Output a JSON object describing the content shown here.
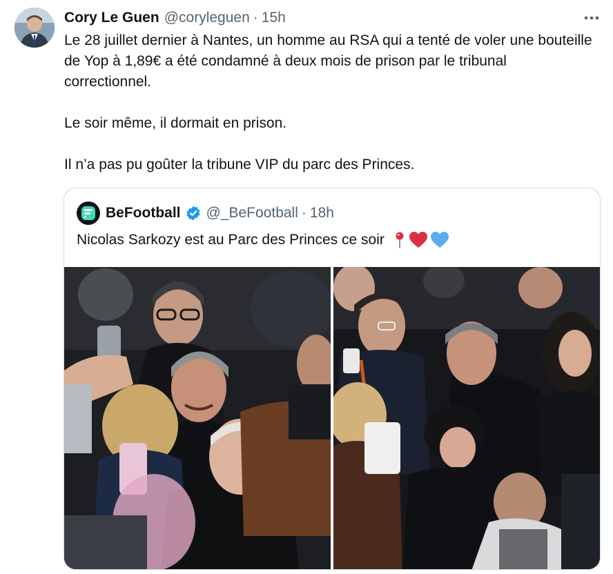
{
  "tweet": {
    "author_name": "Cory Le Guen",
    "author_handle": "@coryleguen",
    "separator": "·",
    "time": "15h",
    "more_icon": "ellipsis-icon",
    "paragraphs": [
      "Le 28 juillet dernier à Nantes, un homme au RSA qui a tenté de voler une bouteille de Yop à 1,89€ a été condamné à deux mois de prison par le tribunal correctionnel.",
      "Le soir même, il dormait en prison.",
      "Il n’a pas pu goûter la tribune VIP du parc des Princes."
    ]
  },
  "quote": {
    "author_name": "BeFootball",
    "author_handle": "@_BeFootball",
    "separator": "·",
    "time": "18h",
    "verified_icon": "verified-badge-icon",
    "text": "Nicolas Sarkozy est au Parc des Princes ce soir",
    "emojis": [
      "round-pushpin-icon",
      "red-heart-icon",
      "blue-heart-icon"
    ],
    "photos": [
      "stadium-crowd-photo-left",
      "stadium-crowd-photo-right"
    ]
  },
  "colors": {
    "text": "#0f1419",
    "secondary": "#536471",
    "border": "#cfd9de",
    "verified": "#1d9bf0",
    "heart_red": "#dd2e44",
    "heart_blue": "#5dadec"
  }
}
